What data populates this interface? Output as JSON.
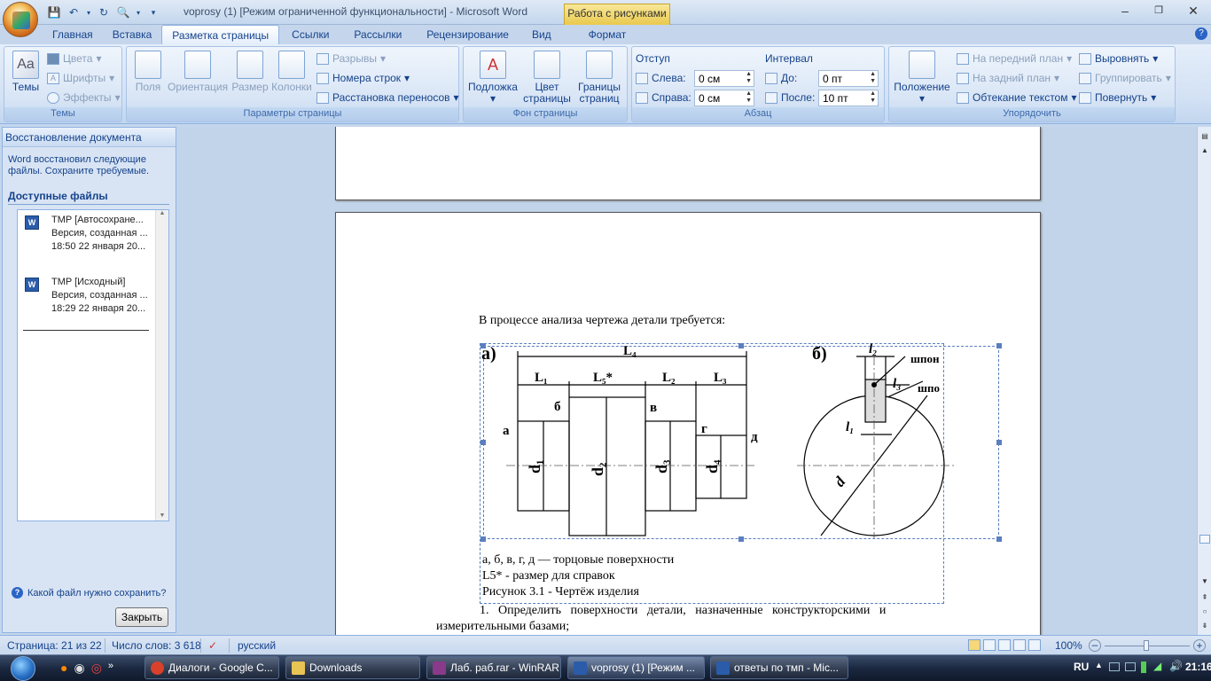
{
  "window": {
    "title": "voprosy (1) [Режим ограниченной функциональности] - Microsoft Word",
    "context_tab": "Работа с рисунками",
    "buttons": {
      "minimize": "–",
      "maximize": "❐",
      "close": "✕"
    }
  },
  "tabs": [
    "Главная",
    "Вставка",
    "Разметка страницы",
    "Ссылки",
    "Рассылки",
    "Рецензирование",
    "Вид",
    "Формат"
  ],
  "ribbon": {
    "themes": {
      "label": "Темы",
      "big": "Темы",
      "colors": "Цвета",
      "fonts": "Шрифты",
      "effects": "Эффекты"
    },
    "page_setup": {
      "label": "Параметры страницы",
      "margins": "Поля",
      "orientation": "Ориентация",
      "size": "Размер",
      "columns": "Колонки",
      "breaks": "Разрывы",
      "line_numbers": "Номера строк",
      "hyphenation": "Расстановка переносов"
    },
    "page_background": {
      "label": "Фон страницы",
      "watermark": "Подложка",
      "page_color_1": "Цвет",
      "page_color_2": "страницы",
      "page_borders_1": "Границы",
      "page_borders_2": "страниц"
    },
    "paragraph": {
      "label": "Абзац",
      "indent": "Отступ",
      "left": "Слева:",
      "left_value": "0 см",
      "right": "Справа:",
      "right_value": "0 см",
      "spacing": "Интервал",
      "before": "До:",
      "before_value": "0 пт",
      "after": "После:",
      "after_value": "10 пт"
    },
    "arrange": {
      "label": "Упорядочить",
      "position": "Положение",
      "bring_front": "На передний план",
      "send_back": "На задний план",
      "text_wrap": "Обтекание текстом",
      "align": "Выровнять",
      "group": "Группировать",
      "rotate": "Повернуть"
    }
  },
  "recovery_pane": {
    "title": "Восстановление документа",
    "description": "Word восстановил следующие файлы.  Сохраните требуемые.",
    "available": "Доступные файлы",
    "files": [
      {
        "name": "TMP  [Автосохране...",
        "line2": "Версия, созданная ...",
        "line3": "18:50 22 января 20..."
      },
      {
        "name": "TMP  [Исходный]",
        "line2": "Версия, созданная ...",
        "line3": "18:29 22 января 20..."
      }
    ],
    "help_link": "Какой файл нужно сохранить?",
    "close_button": "Закрыть"
  },
  "document": {
    "intro": "В процессе анализа чертежа детали требуется:",
    "figure": {
      "label_a": "а)",
      "label_b": "б)",
      "dims_top": [
        "L₄"
      ],
      "dims": [
        "L₁",
        "L₅*",
        "L₂",
        "L₃"
      ],
      "faces": [
        "а",
        "б",
        "в",
        "г",
        "д"
      ],
      "diameters": [
        "d₁",
        "d₂",
        "d₃",
        "d₄"
      ],
      "right_labels": {
        "l2": "l₂",
        "l3": "l₃",
        "l1": "l₁",
        "d": "d",
        "shpon1": "шпон",
        "shpon2": "шпо"
      }
    },
    "caption_lines": [
      "а, б, в, г, д — торцовые поверхности",
      "L5* - размер для справок",
      "Рисунок 3.1 - Чертёж изделия"
    ],
    "item1_line1": "1.   Определить   поверхности   детали,   назначенные   конструкторскими   и",
    "item1_line2": "измерительными базами;"
  },
  "statusbar": {
    "page": "Страница: 21 из 22",
    "words": "Число слов: 3 618",
    "lang": "русский",
    "zoom": "100%"
  },
  "taskbar": {
    "tasks": [
      {
        "label": "Диалоги - Google C...",
        "color": "#d9412b"
      },
      {
        "label": "Downloads",
        "color": "#e8c454"
      },
      {
        "label": "Лаб. раб.rar - WinRAR",
        "color": "#8a3a8a"
      },
      {
        "label": "voprosy (1) [Режим ...",
        "color": "#2a5caa"
      },
      {
        "label": "ответы по тмп - Mic...",
        "color": "#2a5caa"
      }
    ],
    "lang": "RU",
    "time": "21:16"
  }
}
